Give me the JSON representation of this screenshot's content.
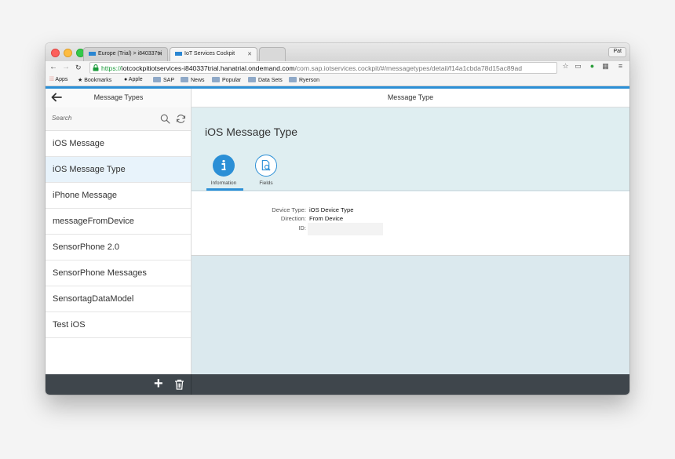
{
  "browser": {
    "tabs": [
      {
        "label": "Europe (Trial) > i840337tri"
      },
      {
        "label": "IoT Services Cockpit"
      }
    ],
    "profile": "Pat",
    "url": {
      "scheme": "https://",
      "host": "iotcockpitiotservices-i840337trial.hanatrial.ondemand.com",
      "path": "/com.sap.iotservices.cockpit/#/messagetypes/detail/f14a1cbda78d15ac89ad"
    },
    "bookmarks": [
      "Apps",
      "Bookmarks",
      "Apple",
      "SAP",
      "News",
      "Popular",
      "Data Sets",
      "Ryerson"
    ]
  },
  "master": {
    "title": "Message Types",
    "search_placeholder": "Search",
    "items": [
      {
        "label": "iOS Message"
      },
      {
        "label": "iOS Message Type"
      },
      {
        "label": "iPhone Message"
      },
      {
        "label": "messageFromDevice"
      },
      {
        "label": "SensorPhone 2.0"
      },
      {
        "label": "SensorPhone Messages"
      },
      {
        "label": "SensortagDataModel"
      },
      {
        "label": "Test iOS"
      }
    ],
    "selected_index": 1
  },
  "detail": {
    "header_title": "Message Type",
    "object_title": "iOS Message Type",
    "tabs": [
      {
        "label": "Information",
        "icon": "info-icon"
      },
      {
        "label": "Fields",
        "icon": "document-search-icon"
      }
    ],
    "fields": [
      {
        "label": "Device Type:",
        "value": "iOS Device Type"
      },
      {
        "label": "Direction:",
        "value": "From Device"
      },
      {
        "label": "ID:",
        "value": ""
      }
    ]
  },
  "colors": {
    "accent": "#2b8fd6",
    "footer": "#3f464c",
    "selected_row": "#e8f3fb",
    "detail_bg": "#dbe9ee"
  }
}
